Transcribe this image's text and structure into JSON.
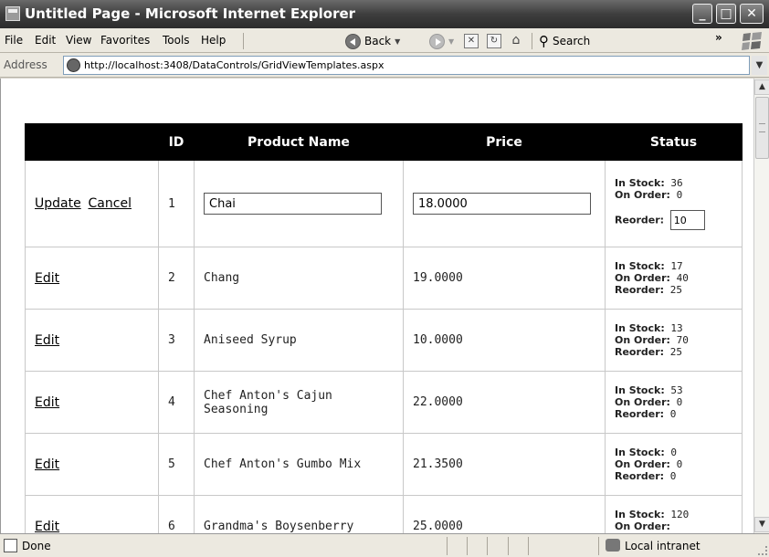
{
  "window": {
    "title": "Untitled Page - Microsoft Internet Explorer"
  },
  "menu": {
    "file": "File",
    "edit": "Edit",
    "view": "View",
    "favorites": "Favorites",
    "tools": "Tools",
    "help": "Help"
  },
  "toolbar": {
    "back": "Back",
    "search": "Search",
    "chevron": "»"
  },
  "address": {
    "label": "Address",
    "url": "http://localhost:3408/DataControls/GridViewTemplates.aspx"
  },
  "grid": {
    "headers": {
      "id": "ID",
      "name": "Product Name",
      "price": "Price",
      "status": "Status"
    },
    "labels": {
      "in_stock": "In Stock:",
      "on_order": "On Order:",
      "reorder": "Reorder:"
    },
    "edit_row": {
      "update": "Update",
      "cancel": "Cancel",
      "id": "1",
      "name": "Chai",
      "price": "18.0000",
      "in_stock": "36",
      "on_order": "0",
      "reorder": "10"
    },
    "rows": [
      {
        "action": "Edit",
        "id": "2",
        "name": "Chang",
        "price": "19.0000",
        "in_stock": "17",
        "on_order": "40",
        "reorder": "25"
      },
      {
        "action": "Edit",
        "id": "3",
        "name": "Aniseed Syrup",
        "price": "10.0000",
        "in_stock": "13",
        "on_order": "70",
        "reorder": "25"
      },
      {
        "action": "Edit",
        "id": "4",
        "name": "Chef Anton's Cajun Seasoning",
        "price": "22.0000",
        "in_stock": "53",
        "on_order": "0",
        "reorder": "0"
      },
      {
        "action": "Edit",
        "id": "5",
        "name": "Chef Anton's Gumbo Mix",
        "price": "21.3500",
        "in_stock": "0",
        "on_order": "0",
        "reorder": "0"
      },
      {
        "action": "Edit",
        "id": "6",
        "name": "Grandma's Boysenberry",
        "price": "25.0000",
        "in_stock": "120",
        "on_order": "",
        "reorder": ""
      }
    ]
  },
  "status_bar": {
    "text": "Done",
    "zone": "Local intranet"
  }
}
